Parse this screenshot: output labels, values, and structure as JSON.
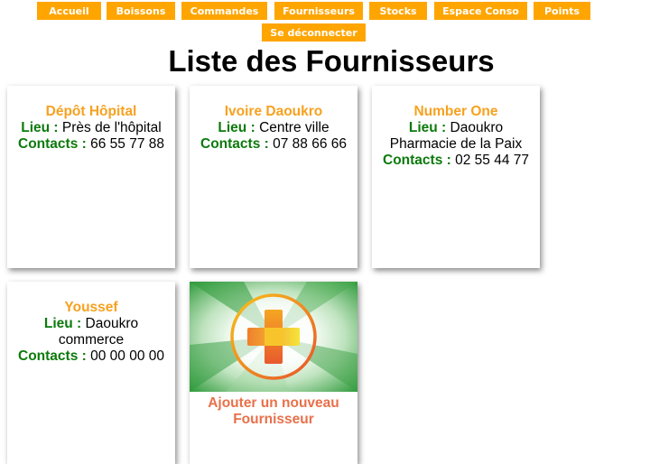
{
  "nav": {
    "accueil": "Accueil",
    "boissons": "Boissons",
    "commandes": "Commandes",
    "fournisseurs": "Fournisseurs",
    "stocks": "Stocks",
    "espace_conso": "Espace Conso",
    "points": "Points",
    "deconnecter": "Se déconnecter"
  },
  "page": {
    "title": "Liste des Fournisseurs"
  },
  "labels": {
    "lieu": "Lieu :",
    "contacts": "Contacts :"
  },
  "suppliers": [
    {
      "name": "Dépôt Hôpital",
      "lieu": "Près de l'hôpital",
      "contacts": "66 55 77 88"
    },
    {
      "name": "Ivoire Daoukro",
      "lieu": "Centre ville",
      "contacts": "07 88 66 66"
    },
    {
      "name": "Number One",
      "lieu": "Daoukro Pharmacie de la Paix",
      "contacts": "02 55 44 77"
    },
    {
      "name": "Youssef",
      "lieu": "Daoukro commerce",
      "contacts": "00 00 00 00"
    }
  ],
  "add_card": {
    "label": "Ajouter un nouveau Fournisseur",
    "icon": "plus-icon"
  },
  "colors": {
    "nav_bg": "#ffa500",
    "supplier_name": "#f7a11f",
    "label_green": "#0c7a0c",
    "add_label": "#e8704a"
  }
}
